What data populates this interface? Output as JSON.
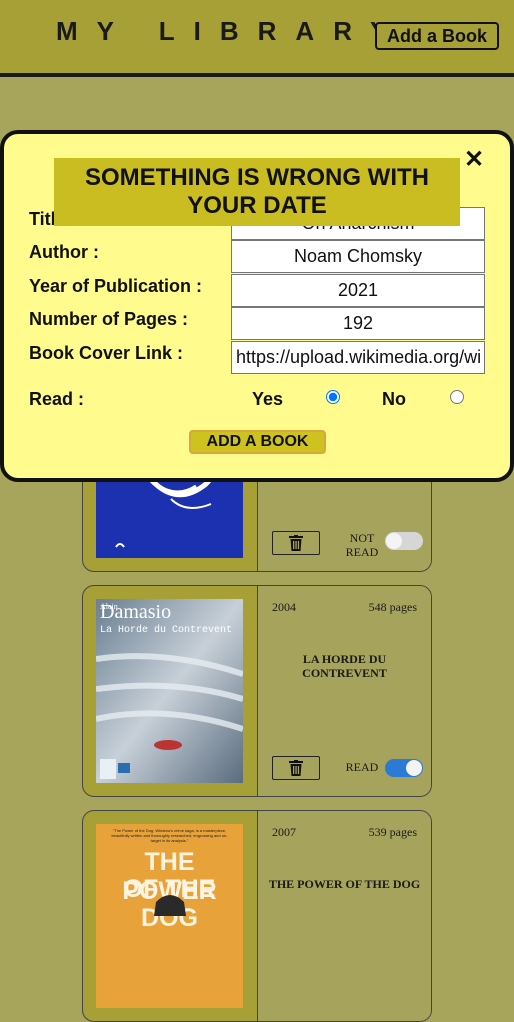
{
  "header": {
    "title": "MY LIBRARY",
    "add_book_label": "Add a Book"
  },
  "books": [
    {
      "read_label": "NOT READ",
      "read": false
    },
    {
      "cover_author": "Alain",
      "cover_title": "Damasio",
      "cover_subtitle": "La Horde du Contrevent",
      "year": "2004",
      "pages": "548 pages",
      "title": "LA HORDE DU CONTREVENT",
      "read_label": "READ",
      "read": true
    },
    {
      "cover_blurb": "\"The Power of the Dog, Winslow's crime saga, is a masterpiece, beautifully written and thoroughly researched, engrossing and on-target in its analysis.\"",
      "cover_title_line1": "THE POWER",
      "cover_title_line2": "OF THE DOG",
      "year": "2007",
      "pages": "539 pages",
      "title": "THE POWER OF THE DOG"
    }
  ],
  "form": {
    "error": "SOMETHING IS WRONG WITH YOUR DATE",
    "title_label": "Title :",
    "title_value": "On Anarchism",
    "author_label": "Author :",
    "author_value": "Noam Chomsky",
    "year_label": "Year of Publication :",
    "year_value": "2021",
    "pages_label": "Number of Pages :",
    "pages_value": "192",
    "cover_label": "Book Cover Link :",
    "cover_value": "https://upload.wikimedia.org/wikipedia",
    "read_label": "Read :",
    "yes_label": "Yes",
    "no_label": "No",
    "read_value": "yes",
    "submit_label": "ADD A BOOK",
    "close_glyph": "✕"
  },
  "colors": {
    "background": "#a7a55c",
    "header": "#a6a036",
    "overlay": "#fffb8c",
    "error_banner": "#c9bd22",
    "toggle_on": "#2b7bd6",
    "toggle_off": "#d6d6d6"
  },
  "icons": [
    "trash-icon",
    "close-icon"
  ]
}
